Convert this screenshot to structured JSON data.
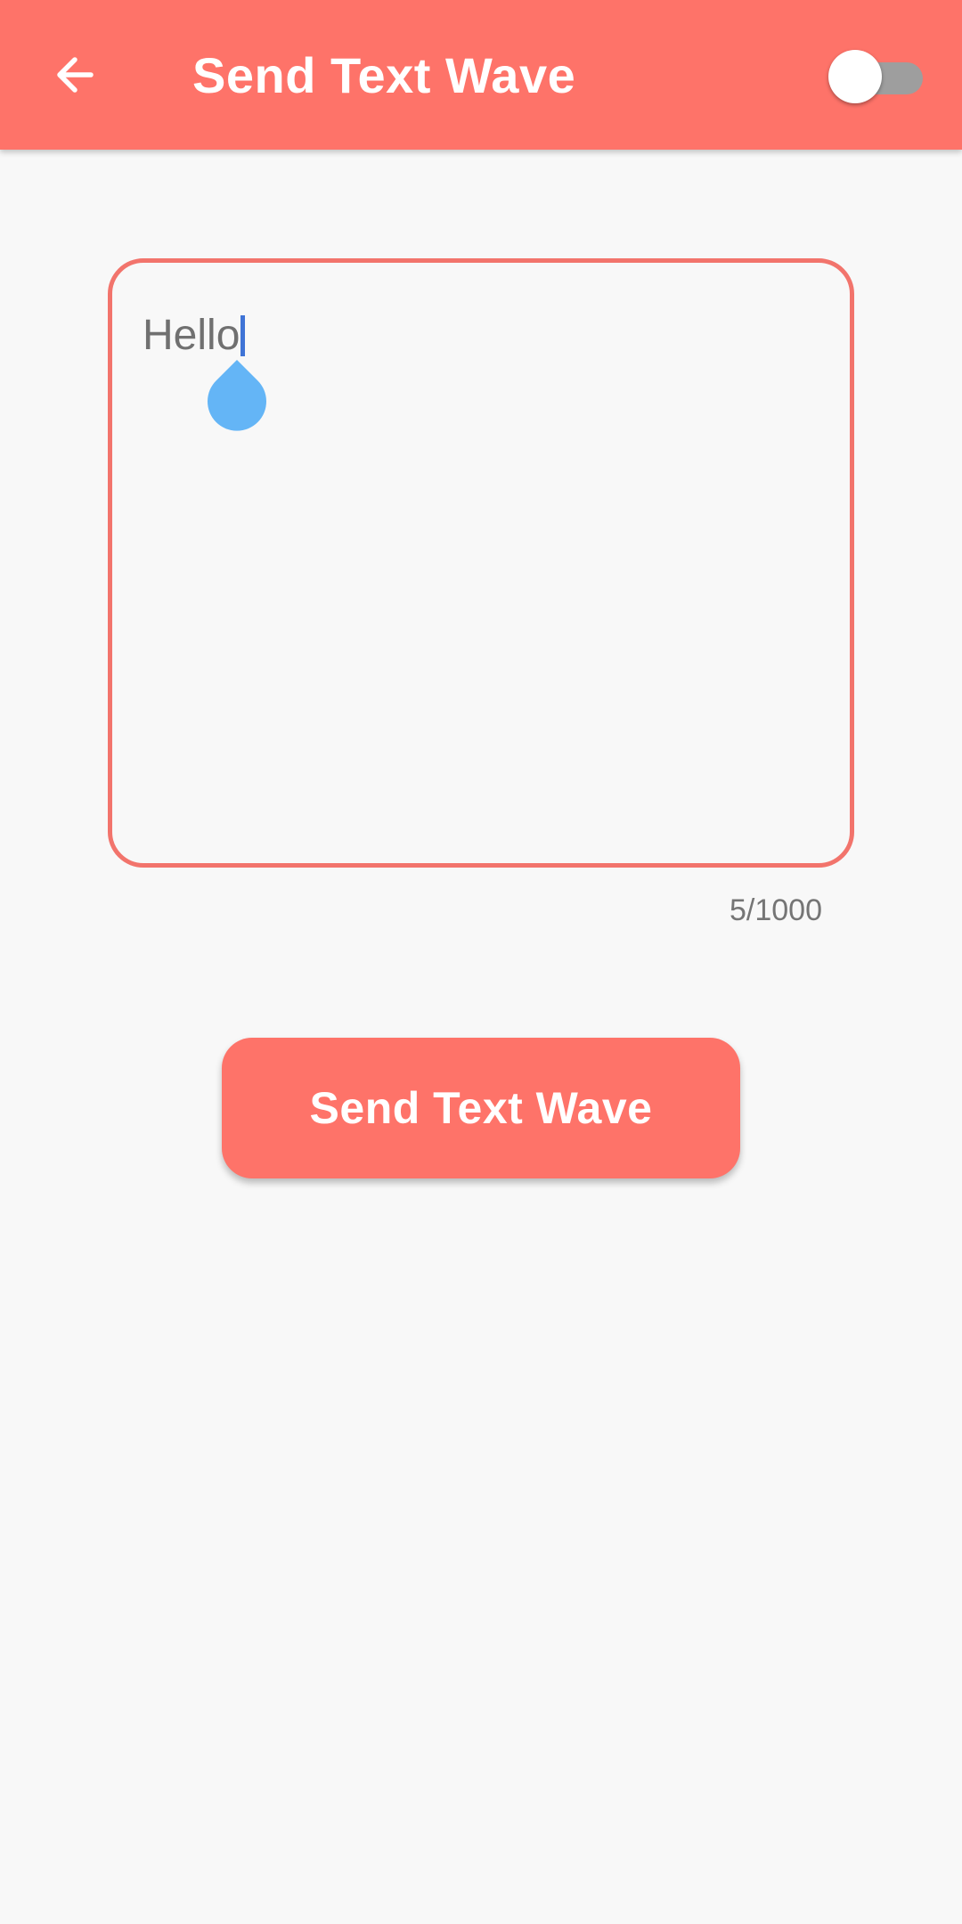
{
  "app_bar": {
    "title": "Send Text Wave",
    "back_icon": "arrow-left-icon",
    "toggle_on": false,
    "background_color": "#FE7369"
  },
  "message": {
    "value": "Hello",
    "counter": "5/1000",
    "border_color": "#F2746C",
    "cursor_color": "#3F74D6",
    "handle_color": "#64B5F6"
  },
  "send_button": {
    "label": "Send Text Wave",
    "color": "#FE7369"
  }
}
